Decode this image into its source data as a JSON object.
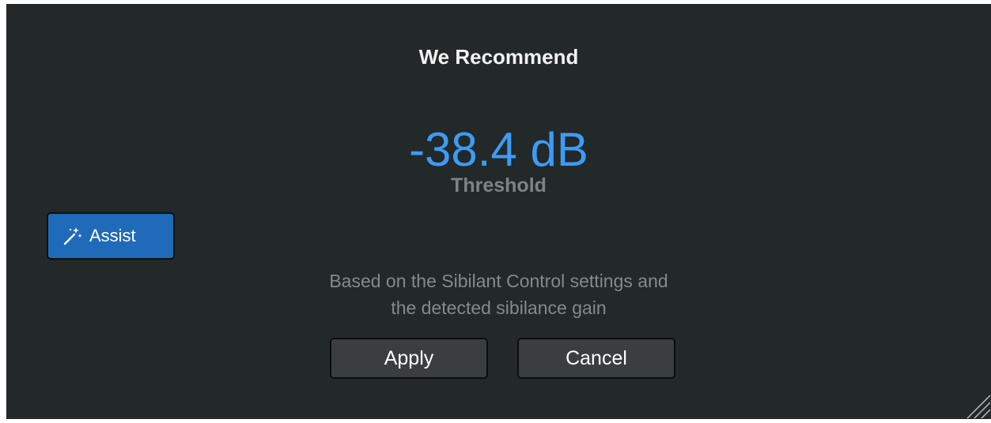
{
  "dialog": {
    "title": "We Recommend",
    "recommendation": {
      "value": "-38.4 dB",
      "label": "Threshold"
    },
    "assist_button": {
      "label": "Assist",
      "icon": "magic-wand-icon"
    },
    "description": {
      "line1": "Based on the Sibilant Control settings and",
      "line2": "the detected sibilance gain"
    },
    "buttons": {
      "apply": "Apply",
      "cancel": "Cancel"
    },
    "resize_icon": "resize-handle-icon"
  },
  "colors": {
    "background": "#232829",
    "accent_value": "#3b9cf5",
    "assist_button": "#1f6ab9",
    "button": "#3a3e41",
    "muted_text": "#85898b"
  }
}
